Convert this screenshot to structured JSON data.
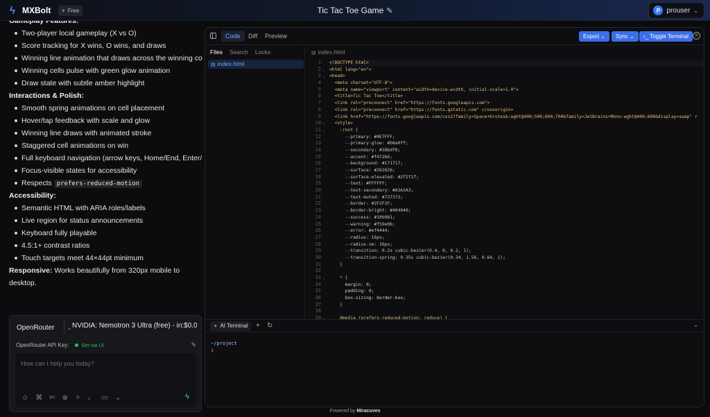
{
  "app": {
    "brand": "MXBolt",
    "plan": "Free",
    "project_title": "Tic Tac Toe Game",
    "user": "prouser",
    "avatar": "P"
  },
  "chat": {
    "cut_heading": "Gameplay Features:",
    "gameplay": [
      "Two-player local gameplay (X vs O)",
      "Score tracking for X wins, O wins, and draws",
      "Winning line animation that draws across the winning combination",
      "Winning cells pulse with green glow animation",
      "Draw state with subtle amber highlight"
    ],
    "interactions_heading": "Interactions & Polish:",
    "interactions": [
      "Smooth spring animations on cell placement",
      "Hover/tap feedback with scale and glow",
      "Winning line draws with animated stroke",
      "Staggered cell animations on win",
      "Full keyboard navigation (arrow keys, Home/End, Enter/Space)",
      "Focus-visible states for accessibility"
    ],
    "respects_prefix": "Respects",
    "respects_code": "prefers-reduced-motion",
    "accessibility_heading": "Accessibility:",
    "accessibility": [
      "Semantic HTML with ARIA roles/labels",
      "Live region for status announcements",
      "Keyboard fully playable",
      "4.5:1+ contrast ratios",
      "Touch targets meet 44×44pt minimum"
    ],
    "responsive_label": "Responsive:",
    "responsive_text": "Works beautifully from 320px mobile to desktop."
  },
  "composer": {
    "provider": "OpenRouter",
    "model": "NVIDIA: Nemotron 3 Ultra (free) - in:$0.0…",
    "api_key_label": "OpenRouter API Key:",
    "api_key_status": "Set via UI",
    "placeholder": "How can I help you today?"
  },
  "editor": {
    "tabs": [
      "Code",
      "Diff",
      "Preview"
    ],
    "buttons": {
      "export": "Export",
      "sync": "Sync",
      "toggle_terminal": "Toggle Terminal"
    },
    "file_tabs": [
      "Files",
      "Search",
      "Locks"
    ],
    "file": "index.html",
    "open_file": "index.html",
    "code_lines": [
      "<!DOCTYPE html>",
      "<html lang=\"en\">",
      "<head>",
      "  <meta charset=\"UTF-8\">",
      "  <meta name=\"viewport\" content=\"width=device-width, initial-scale=1.0\">",
      "  <title>Tic Tac Toe</title>",
      "  <link rel=\"preconnect\" href=\"https://fonts.googleapis.com\">",
      "  <link rel=\"preconnect\" href=\"https://fonts.gstatic.com\" crossorigin>",
      "  <link href=\"https://fonts.googleapis.com/css2?family=Space+Grotesk:wght@400;500;600;700&family=JetBrains+Mono:wght@400;600&display=swap\" r",
      "  <style>",
      "    :root {",
      "      --primary: #0E7FFF;",
      "      --primary-glow: #b8a0ff;",
      "      --secondary: #38bdf8;",
      "      --accent: #f472b6;",
      "      --background: #171717;",
      "      --surface: #262626;",
      "      --surface-elevated: #2f2f2f;",
      "      --text: #FFFFFF;",
      "      --text-secondary: #A3A3A3;",
      "      --text-muted: #737373;",
      "      --border: #2F2F2F;",
      "      --border-bright: #404040;",
      "      --success: #10b981;",
      "      --warning: #f59e0b;",
      "      --error: #ef4444;",
      "      --radius: 16px;",
      "      --radius-sm: 10px;",
      "      --transition: 0.2s cubic-bezier(0.4, 0, 0.2, 1);",
      "      --transition-spring: 0.35s cubic-bezier(0.34, 1.56, 0.64, 1);",
      "    }",
      "",
      "    * {",
      "      margin: 0;",
      "      padding: 0;",
      "      box-sizing: border-box;",
      "    }",
      "",
      "    @media (prefers-reduced-motion: reduce) {"
    ],
    "fold_marks": {
      "2": "⌄",
      "3": "⌄",
      "10": "⌄",
      "11": "⌄",
      "33": "⌄",
      "39": "⌄"
    }
  },
  "terminal": {
    "tab": "AI Terminal",
    "cwd": "~/project",
    "prompt": "❯"
  },
  "footer": {
    "prefix": "Powered by",
    "brand": "Miracuves"
  },
  "colors": {
    "accent": "#3b6fe8",
    "success": "#22c55e"
  }
}
